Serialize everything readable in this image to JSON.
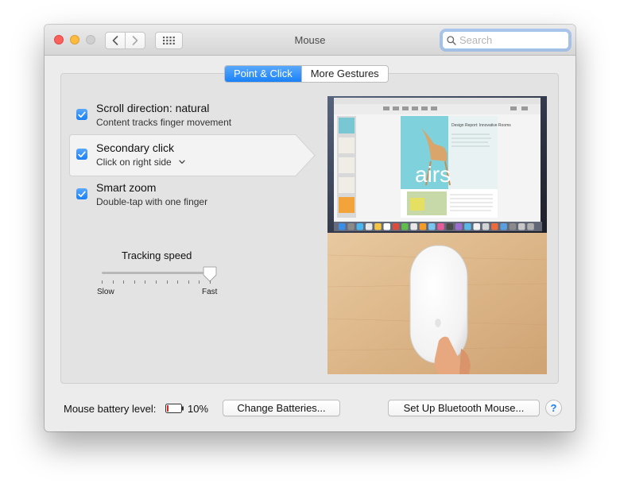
{
  "window": {
    "title": "Mouse"
  },
  "toolbar": {
    "search_placeholder": "Search"
  },
  "tabs": [
    {
      "label": "Point & Click",
      "active": true
    },
    {
      "label": "More Gestures",
      "active": false
    }
  ],
  "options": [
    {
      "title": "Scroll direction: natural",
      "subtitle": "Content tracks finger movement",
      "checked": true
    },
    {
      "title": "Secondary click",
      "subtitle": "Click on right side",
      "checked": true,
      "has_dropdown": true
    },
    {
      "title": "Smart zoom",
      "subtitle": "Double-tap with one finger",
      "checked": true
    }
  ],
  "tracking": {
    "label": "Tracking speed",
    "min_label": "Slow",
    "max_label": "Fast",
    "value_fraction": 1.0
  },
  "preview": {
    "doc_heading": "Design Report: Innovative Rooms",
    "doc_big_text": "airs"
  },
  "footer": {
    "battery_label": "Mouse battery level:",
    "battery_value": "10%",
    "battery_fraction": 0.1,
    "change_batteries": "Change Batteries...",
    "setup_bluetooth": "Set Up Bluetooth Mouse...",
    "help": "?"
  },
  "colors": {
    "accent": "#1a82f7",
    "battery_low": "#e0271f"
  }
}
